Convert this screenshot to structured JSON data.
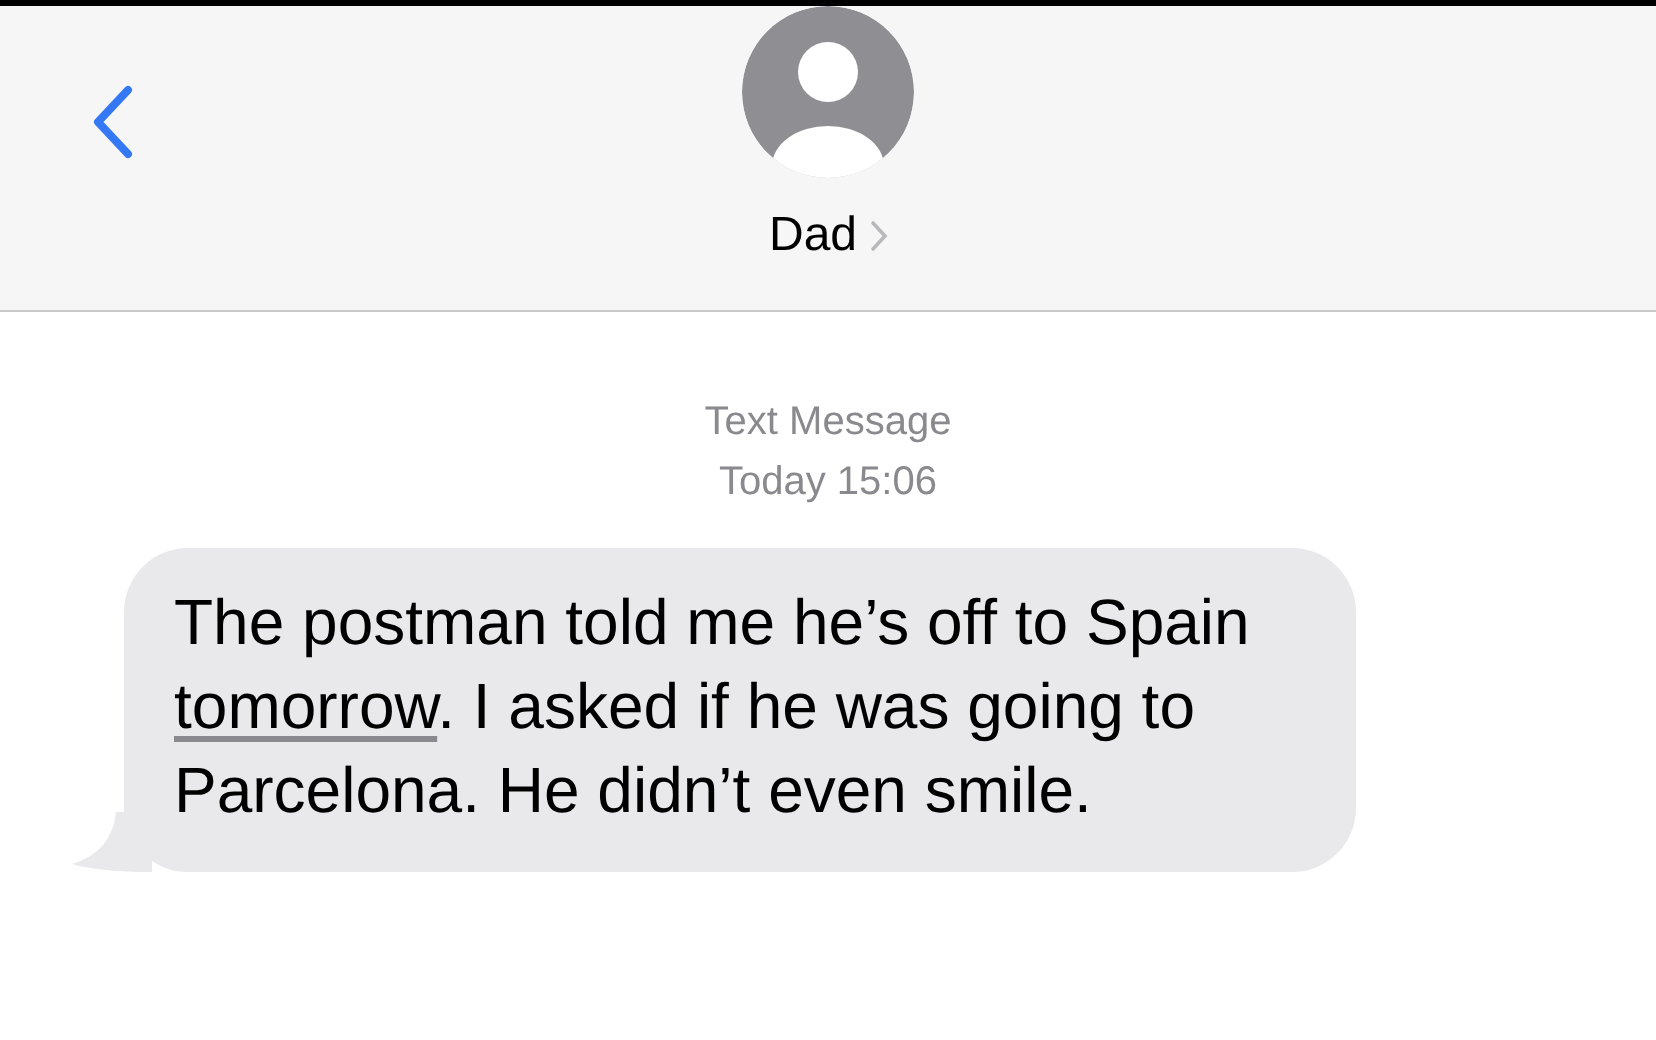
{
  "header": {
    "contact_name": "Dad"
  },
  "thread": {
    "service": "Text Message",
    "timestamp": "Today 15:06"
  },
  "messages": [
    {
      "kind": "incoming",
      "segments": [
        {
          "text": "The postman told me he’s off to Spain ",
          "link": false
        },
        {
          "text": "tomorrow",
          "link": true
        },
        {
          "text": ". I asked if he was going to Parcelona. He didn’t even smile.",
          "link": false
        }
      ]
    }
  ]
}
